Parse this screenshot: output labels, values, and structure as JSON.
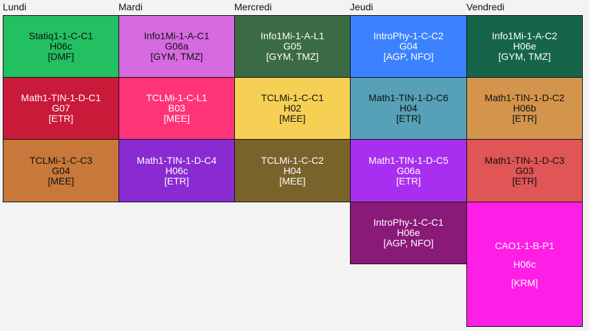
{
  "days": [
    "Lundi",
    "Mardi",
    "Mercredi",
    "Jeudi",
    "Vendredi"
  ],
  "slots": {
    "lun_1": {
      "course": "Statiq1-1-C-C1",
      "room": "H06c",
      "teachers": "[DMF]",
      "color": "#22c060"
    },
    "lun_2": {
      "course": "Math1-TIN-1-D-C1",
      "room": "G07",
      "teachers": "[ETR]",
      "color": "#c91a3a"
    },
    "lun_3": {
      "course": "TCLMi-1-C-C3",
      "room": "G04",
      "teachers": "[MEE]",
      "color": "#c8783a"
    },
    "mar_1": {
      "course": "Info1Mi-1-A-C1",
      "room": "G06a",
      "teachers": "[GYM, TMZ]",
      "color": "#d66ae0"
    },
    "mar_2": {
      "course": "TCLMi-1-C-L1",
      "room": "B03",
      "teachers": "[MEE]",
      "color": "#ff3378"
    },
    "mar_3": {
      "course": "Math1-TIN-1-D-C4",
      "room": "H06c",
      "teachers": "[ETR]",
      "color": "#8a2bd2"
    },
    "mer_1": {
      "course": "Info1Mi-1-A-L1",
      "room": "G05",
      "teachers": "[GYM, TMZ]",
      "color": "#3b6b44"
    },
    "mer_2": {
      "course": "TCLMi-1-C-C1",
      "room": "H02",
      "teachers": "[MEE]",
      "color": "#f5d055"
    },
    "mer_3": {
      "course": "TCLMi-1-C-C2",
      "room": "H04",
      "teachers": "[MEE]",
      "color": "#7a632b"
    },
    "jeu_1": {
      "course": "IntroPhy-1-C-C2",
      "room": "G04",
      "teachers": "[AGP, NFO]",
      "color": "#3c82ff"
    },
    "jeu_2": {
      "course": "Math1-TIN-1-D-C6",
      "room": "H04",
      "teachers": "[ETR]",
      "color": "#56a0b8"
    },
    "jeu_3": {
      "course": "Math1-TIN-1-D-C5",
      "room": "G06a",
      "teachers": "[ETR]",
      "color": "#a92ff0"
    },
    "jeu_4": {
      "course": "IntroPhy-1-C-C1",
      "room": "H06e",
      "teachers": "[AGP, NFO]",
      "color": "#8a1a78"
    },
    "ven_1": {
      "course": "Info1Mi-1-A-C2",
      "room": "H06e",
      "teachers": "[GYM, TMZ]",
      "color": "#16654a"
    },
    "ven_2": {
      "course": "Math1-TIN-1-D-C2",
      "room": "H06b",
      "teachers": "[ETR]",
      "color": "#d3944c"
    },
    "ven_3": {
      "course": "Math1-TIN-1-D-C3",
      "room": "G03",
      "teachers": "[ETR]",
      "color": "#e05555"
    },
    "ven_4": {
      "course": "CAO1-1-B-P1",
      "room": "H06c",
      "teachers": "[KRM]",
      "color": "#ff1ee6"
    }
  }
}
